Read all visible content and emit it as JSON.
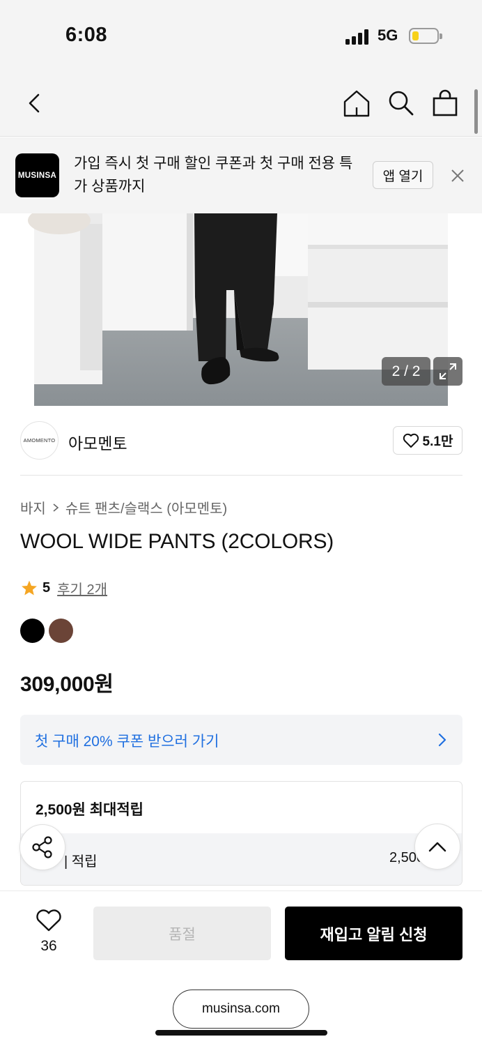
{
  "status_bar": {
    "time": "6:08",
    "network": "5G",
    "battery_level": 0.25
  },
  "header": {
    "back_icon": "chevron-left-icon",
    "home_icon": "home-icon",
    "search_icon": "search-icon",
    "bag_icon": "shopping-bag-icon"
  },
  "banner": {
    "logo_text": "MUSINSA",
    "text": "가입 즉시 첫 구매 할인 쿠폰과 첫 구매 전용 특가 상품까지",
    "open_app_label": "앱 열기",
    "close_icon": "close-icon"
  },
  "gallery": {
    "counter": "2 / 2",
    "expand_icon": "expand-icon"
  },
  "brand": {
    "logo_text": "AMOMENTO",
    "name": "아모멘토",
    "likes": "5.1만"
  },
  "product": {
    "breadcrumb": [
      "바지",
      "슈트 팬츠/슬랙스 (아모멘토)"
    ],
    "title": "WOOL WIDE PANTS (2COLORS)",
    "rating": "5",
    "reviews": "후기 2개",
    "colors": [
      "#000000",
      "#6b4437"
    ],
    "price": "309,000원"
  },
  "coupon": {
    "text": "첫 구매 20% 쿠폰 받으러 가기"
  },
  "points": {
    "title": "2,500원 최대적립",
    "row_label": "| 적립",
    "row_value": "2,500"
  },
  "bottom_bar": {
    "wish_count": "36",
    "soldout_label": "품절",
    "restock_label": "재입고 알림 신청"
  },
  "browser": {
    "url": "musinsa.com"
  },
  "colors": {
    "coupon_blue": "#1f6fe0",
    "star": "#f5a623",
    "primary": "#000000"
  }
}
